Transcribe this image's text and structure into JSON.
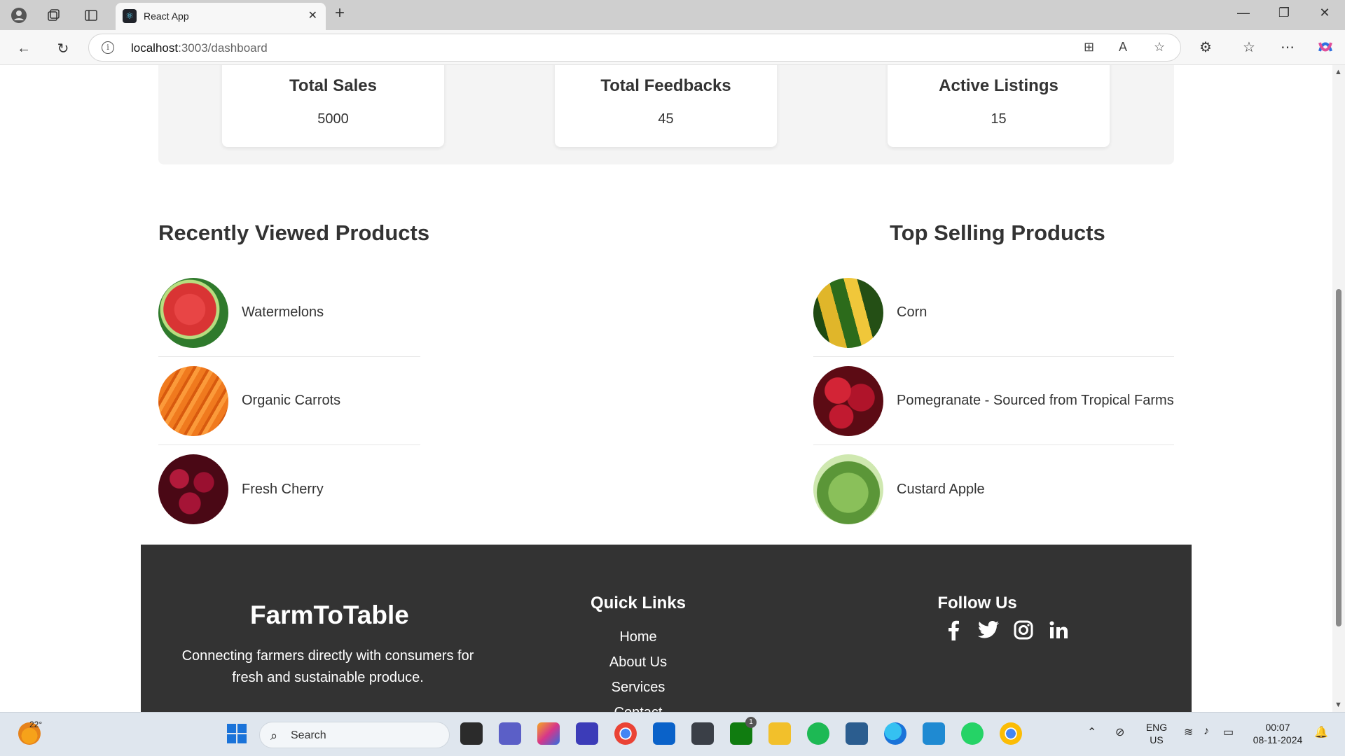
{
  "browser": {
    "tab_title": "React App",
    "url_host": "localhost",
    "url_path": ":3003/dashboard"
  },
  "stats": [
    {
      "label": "Total Sales",
      "value": "5000"
    },
    {
      "label": "Total Feedbacks",
      "value": "45"
    },
    {
      "label": "Active Listings",
      "value": "15"
    }
  ],
  "recently_viewed": {
    "title": "Recently Viewed Products",
    "items": [
      {
        "name": "Watermelons",
        "image": "watermelon-image"
      },
      {
        "name": "Organic Carrots",
        "image": "carrots-image"
      },
      {
        "name": "Fresh Cherry",
        "image": "cherry-image"
      }
    ]
  },
  "top_selling": {
    "title": "Top Selling Products",
    "items": [
      {
        "name": "Corn",
        "image": "corn-image"
      },
      {
        "name": "Pomegranate - Sourced from Tropical Farms",
        "image": "pomegranate-image"
      },
      {
        "name": "Custard Apple",
        "image": "custard-apple-image"
      }
    ]
  },
  "footer": {
    "brand": "FarmToTable",
    "tagline": "Connecting farmers directly with consumers for fresh and sustainable produce.",
    "quick_links_title": "Quick Links",
    "quick_links": [
      "Home",
      "About Us",
      "Services",
      "Contact"
    ],
    "follow_title": "Follow Us",
    "socials": [
      "facebook-icon",
      "twitter-icon",
      "instagram-icon",
      "linkedin-icon"
    ]
  },
  "taskbar": {
    "temperature": "22°",
    "search_placeholder": "Search",
    "language": "ENG",
    "region": "US",
    "time": "00:07",
    "date": "08-11-2024",
    "badge_count": "1"
  }
}
